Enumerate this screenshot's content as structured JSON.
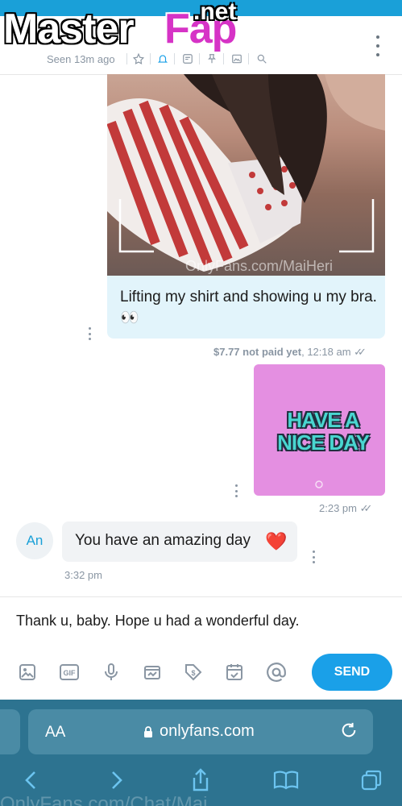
{
  "watermark": {
    "part1": "Master",
    "part2": "Fap",
    "part3": ".net"
  },
  "header": {
    "seen": "Seen 13m ago"
  },
  "messages": {
    "m1": {
      "text": "Lifting my shirt and showing u my bra. 👀",
      "price": "$7.77 not paid yet",
      "time": ", 12:18 am",
      "photo_watermark": "OnlyFans.com/MaiHeri"
    },
    "m2": {
      "sticker_line1": "HAVE A",
      "sticker_line2": "NICE DAY",
      "time": "2:23 pm"
    },
    "m3": {
      "avatar": "An",
      "text": "You have an amazing day",
      "emoji": "❤️",
      "time": "3:32 pm"
    }
  },
  "composer": {
    "value": "Thank u, baby. Hope u had a wonderful day.",
    "send_label": "SEND"
  },
  "browser": {
    "aa": "AA",
    "url": "onlyfans.com",
    "bottom_text": "OnlyFans.com/Chat/Mai"
  },
  "colors": {
    "accent": "#1aa0e8",
    "bubble_out": "#e2f4fb",
    "chrome": "#2d7390"
  }
}
